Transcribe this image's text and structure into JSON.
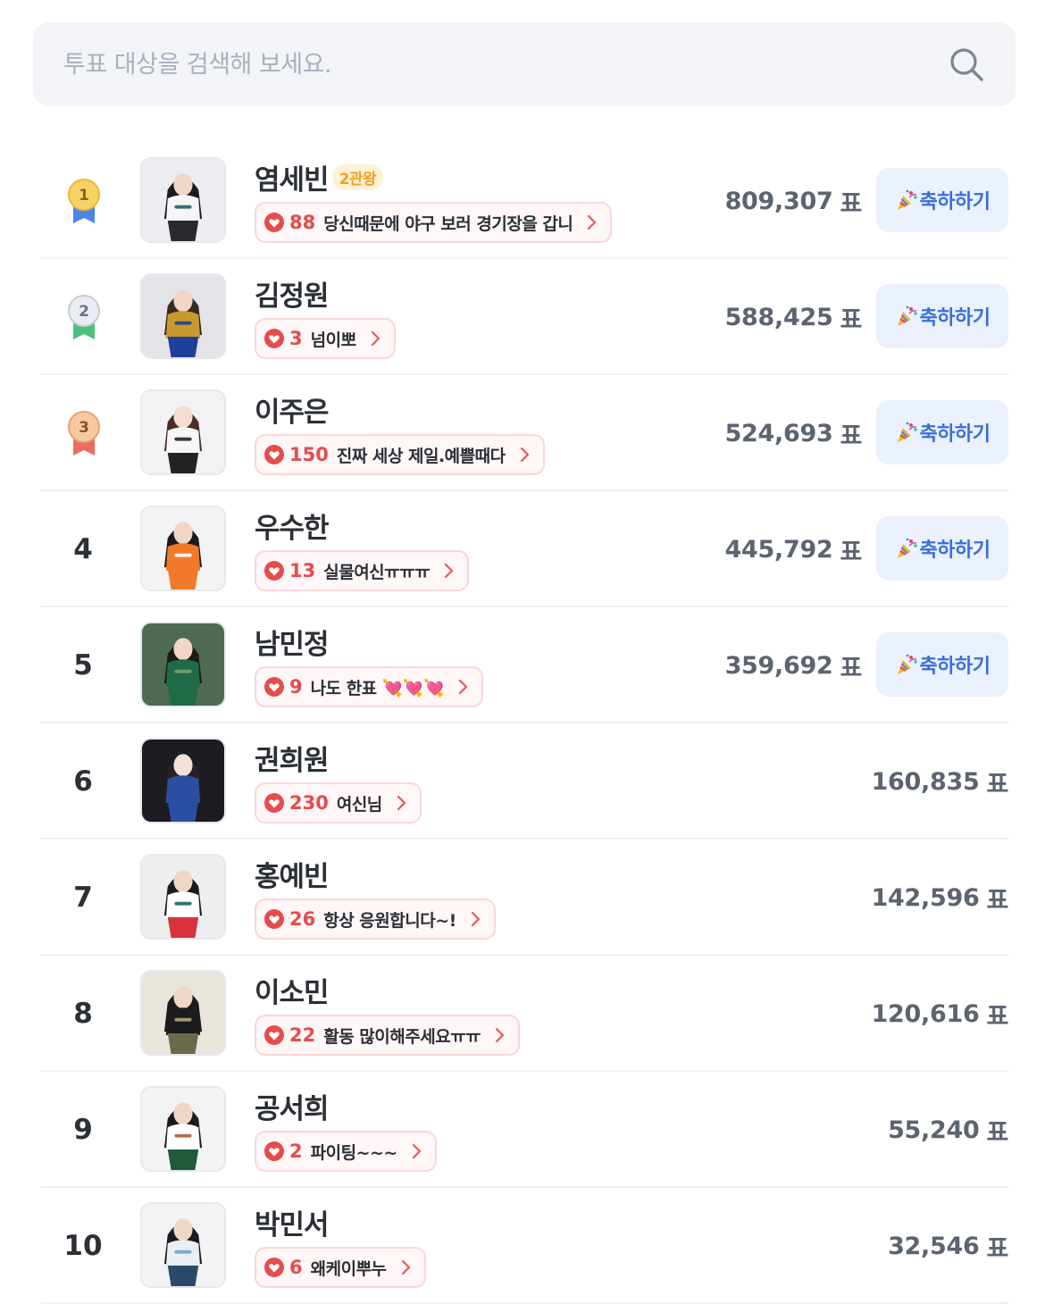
{
  "search": {
    "placeholder": "투표 대상을 검색해 보세요."
  },
  "vote_unit": "표",
  "celebrate_label": "축하하기",
  "items": [
    {
      "rank": "1",
      "medal": "gold",
      "name": "염세빈",
      "badge": "2관왕",
      "comment_count": "88",
      "comment_text": "당신때문에 야구 보러 경기장을 갑니",
      "votes": "809,307",
      "has_celebrate": true,
      "photo": {
        "bg": "#eceef2",
        "top": "#f4f5f7",
        "bottom": "#2a2a2e",
        "hair": "#1c1a1c",
        "skin": "#f1d6c6",
        "accent": "#1f5f66"
      }
    },
    {
      "rank": "2",
      "medal": "silver",
      "name": "김정원",
      "badge": "",
      "comment_count": "3",
      "comment_text": "넘이뽀",
      "votes": "588,425",
      "has_celebrate": true,
      "photo": {
        "bg": "#e4e4e8",
        "top": "#c89a2e",
        "bottom": "#1f3f9a",
        "hair": "#3a2a22",
        "skin": "#f1d6c6",
        "accent": "#1f3f9a"
      }
    },
    {
      "rank": "3",
      "medal": "bronze",
      "name": "이주은",
      "badge": "",
      "comment_count": "150",
      "comment_text": "진짜 세상 제일.예쁠때다",
      "votes": "524,693",
      "has_celebrate": true,
      "photo": {
        "bg": "#f2f2f4",
        "top": "#f7f7f7",
        "bottom": "#222222",
        "hair": "#4a2e22",
        "skin": "#f4dcd0",
        "accent": "#222222"
      }
    },
    {
      "rank": "4",
      "medal": "",
      "name": "우수한",
      "badge": "",
      "comment_count": "13",
      "comment_text": "실물여신ㅠㅠㅠ",
      "votes": "445,792",
      "has_celebrate": true,
      "photo": {
        "bg": "#f3f3f3",
        "top": "#f07a2a",
        "bottom": "#f07a2a",
        "hair": "#1c1a1c",
        "skin": "#f1d6c6",
        "accent": "#ffffff"
      }
    },
    {
      "rank": "5",
      "medal": "",
      "name": "남민정",
      "badge": "",
      "comment_count": "9",
      "comment_text": "나도 한표 💘💘💘",
      "votes": "359,692",
      "has_celebrate": true,
      "photo": {
        "bg": "#4f6a52",
        "top": "#1f6a48",
        "bottom": "#1f6a48",
        "hair": "#1c1a1c",
        "skin": "#f1d6c6",
        "accent": "#7fa07a"
      }
    },
    {
      "rank": "6",
      "medal": "",
      "name": "권희원",
      "badge": "",
      "comment_count": "230",
      "comment_text": "여신님",
      "votes": "160,835",
      "has_celebrate": false,
      "photo": {
        "bg": "#1c1d22",
        "top": "#2a4ea0",
        "bottom": "#2a4ea0",
        "hair": "#2a2024",
        "skin": "#f4e0d8",
        "accent": "#2a4ea0"
      }
    },
    {
      "rank": "7",
      "medal": "",
      "name": "홍예빈",
      "badge": "",
      "comment_count": "26",
      "comment_text": "항상 응원합니다~!",
      "votes": "142,596",
      "has_celebrate": false,
      "photo": {
        "bg": "#eeeeef",
        "top": "#ffffff",
        "bottom": "#d8323c",
        "hair": "#1c1a1c",
        "skin": "#f1d6c6",
        "accent": "#1f5f66"
      }
    },
    {
      "rank": "8",
      "medal": "",
      "name": "이소민",
      "badge": "",
      "comment_count": "22",
      "comment_text": "활동 많이해주세요ㅠㅠ",
      "votes": "120,616",
      "has_celebrate": false,
      "photo": {
        "bg": "#e9e4dc",
        "top": "#1c1c1e",
        "bottom": "#6a6a4a",
        "hair": "#1c1a1c",
        "skin": "#f1d6c6",
        "accent": "#b8a480"
      }
    },
    {
      "rank": "9",
      "medal": "",
      "name": "공서희",
      "badge": "",
      "comment_count": "2",
      "comment_text": "파이팅~~~",
      "votes": "55,240",
      "has_celebrate": false,
      "photo": {
        "bg": "#f3f3f3",
        "top": "#ffffff",
        "bottom": "#1f5a3a",
        "hair": "#1c1a1c",
        "skin": "#f1d6c6",
        "accent": "#b0603a"
      }
    },
    {
      "rank": "10",
      "medal": "",
      "name": "박민서",
      "badge": "",
      "comment_count": "6",
      "comment_text": "왜케이뿌누",
      "votes": "32,546",
      "has_celebrate": false,
      "photo": {
        "bg": "#f3f3f5",
        "top": "#e9eef5",
        "bottom": "#2a4a6a",
        "hair": "#1c1a1c",
        "skin": "#f1d6c6",
        "accent": "#6f9fd0"
      }
    }
  ]
}
